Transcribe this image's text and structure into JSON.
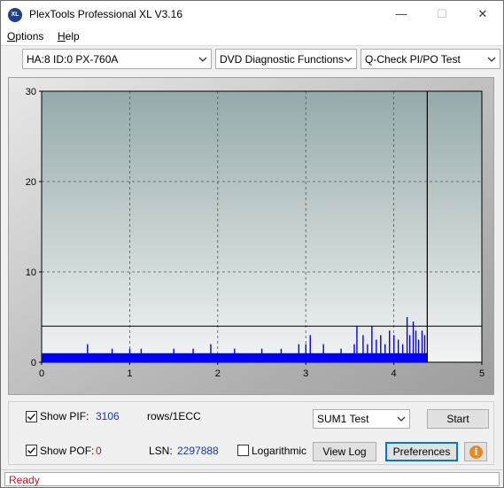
{
  "window": {
    "title": "PlexTools Professional XL V3.16",
    "icon_text": "XL"
  },
  "menu": {
    "options": {
      "accel": "O",
      "rest": "ptions"
    },
    "help": {
      "accel": "H",
      "rest": "elp"
    }
  },
  "toolbar": {
    "drive": "HA:8 ID:0  PX-760A",
    "function": "DVD Diagnostic Functions",
    "test": "Q-Check PI/PO Test"
  },
  "chart_data": {
    "type": "bar",
    "title": "",
    "xlabel": "",
    "ylabel": "",
    "xlim": [
      0,
      5
    ],
    "ylim": [
      0,
      30
    ],
    "x_ticks": [
      0,
      1,
      2,
      3,
      4,
      5
    ],
    "y_ticks": [
      0,
      10,
      20,
      30
    ],
    "grid": true,
    "threshold_line": 4,
    "end_marker_x": 4.38,
    "baseline": 1,
    "series": [
      {
        "color": "#0000ff",
        "spikes": [
          [
            0.52,
            2
          ],
          [
            0.8,
            1.5
          ],
          [
            1.0,
            1.5
          ],
          [
            1.13,
            1.5
          ],
          [
            1.5,
            1.5
          ],
          [
            1.72,
            1.5
          ],
          [
            1.92,
            2
          ],
          [
            2.19,
            1.5
          ],
          [
            2.5,
            1.5
          ],
          [
            2.72,
            1.5
          ],
          [
            2.92,
            2
          ],
          [
            3.0,
            2
          ],
          [
            3.05,
            3
          ],
          [
            3.2,
            2
          ],
          [
            3.4,
            1.5
          ],
          [
            3.55,
            2
          ],
          [
            3.58,
            4
          ],
          [
            3.65,
            3
          ],
          [
            3.7,
            2
          ],
          [
            3.75,
            4
          ],
          [
            3.8,
            2.5
          ],
          [
            3.85,
            3
          ],
          [
            3.9,
            2
          ],
          [
            3.95,
            3.5
          ],
          [
            4.0,
            3
          ],
          [
            4.05,
            2.5
          ],
          [
            4.1,
            2
          ],
          [
            4.15,
            5
          ],
          [
            4.18,
            3
          ],
          [
            4.22,
            4.5
          ],
          [
            4.25,
            3.5
          ],
          [
            4.28,
            2.5
          ],
          [
            4.32,
            3.5
          ],
          [
            4.35,
            3
          ]
        ]
      }
    ]
  },
  "controls": {
    "show_pif_label": "Show PIF:",
    "pif_value": "3106",
    "pif_units": "rows/1ECC",
    "show_pof_label": "Show POF:",
    "pof_value": "0",
    "lsn_label": "LSN:",
    "lsn_value": "2297888",
    "logarithmic_label": "Logarithmic",
    "sum_select": "SUM1 Test",
    "start_label": "Start",
    "view_log_label": "View Log",
    "preferences_label": "Preferences",
    "info_icon": "i"
  },
  "status": {
    "text": "Ready"
  }
}
